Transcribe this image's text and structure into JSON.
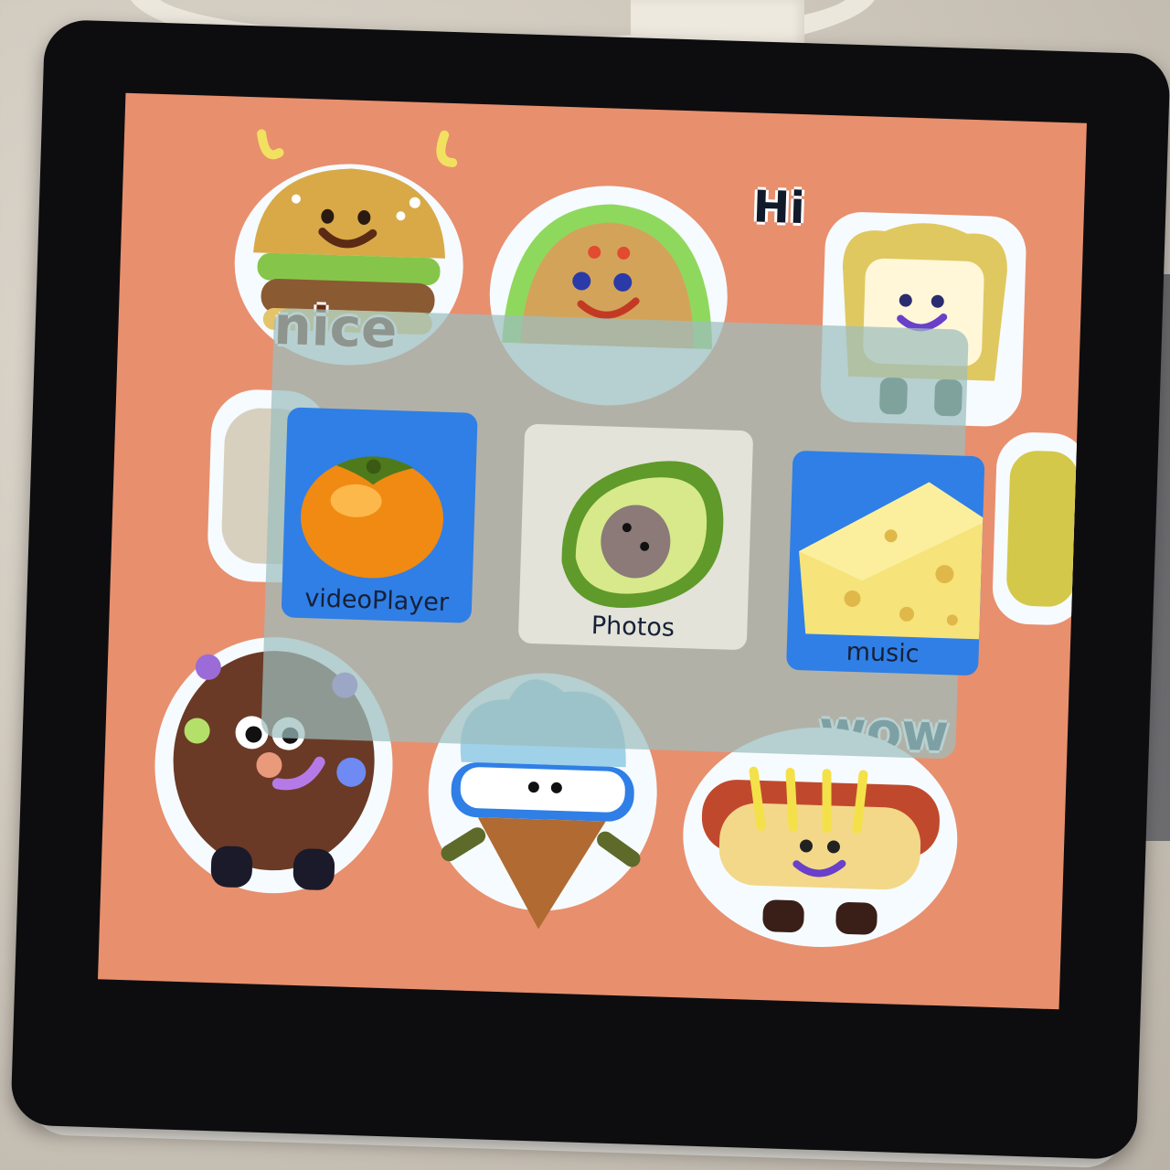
{
  "device": {
    "screen_background": "#e88f6e",
    "overlay_tint": "#9cbebe"
  },
  "stickers": {
    "text_nice": "nice",
    "text_hi": "Hi",
    "text_wow": "wow",
    "items": [
      "burger-sticker",
      "taco-sticker",
      "toast-sticker",
      "donut-sticker",
      "ice-cream-sticker",
      "hotdog-sticker"
    ]
  },
  "launcher": {
    "apps": [
      {
        "label": "videoPlayer",
        "icon": "persimmon-icon",
        "tile_color": "#2f7fe6"
      },
      {
        "label": "Photos",
        "icon": "avocado-icon",
        "tile_color": "#e3e3d9"
      },
      {
        "label": "music",
        "icon": "cheese-icon",
        "tile_color": "#2f7fe6"
      }
    ]
  }
}
